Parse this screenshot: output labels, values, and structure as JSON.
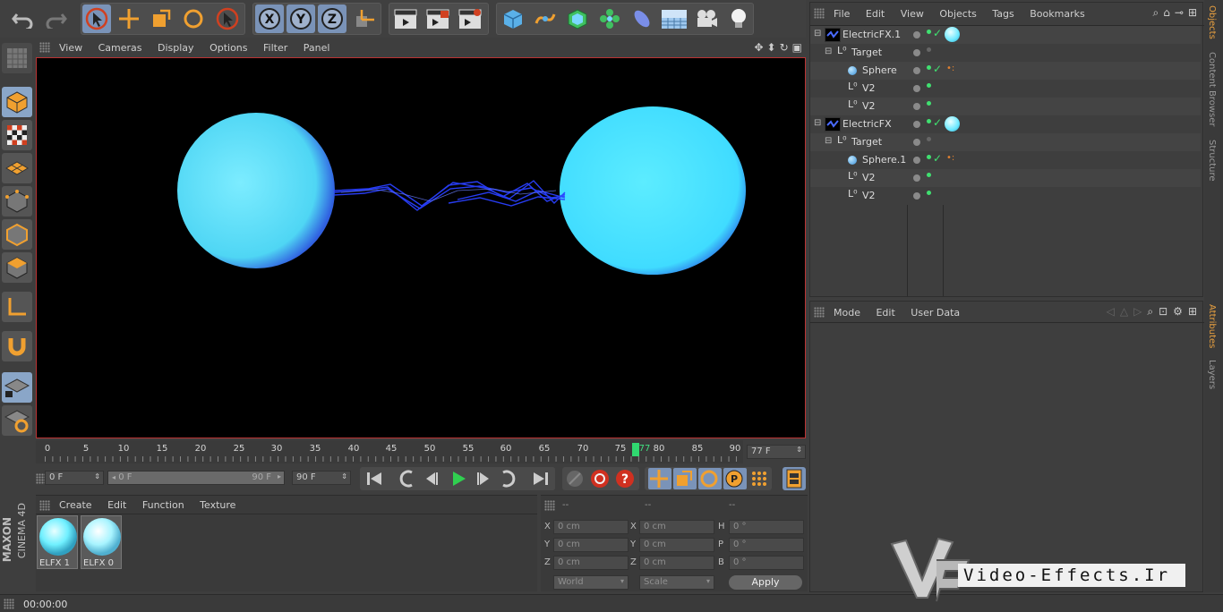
{
  "viewport": {
    "menu": [
      "View",
      "Cameras",
      "Display",
      "Options",
      "Filter",
      "Panel"
    ]
  },
  "objects_panel": {
    "menu": [
      "File",
      "Edit",
      "View",
      "Objects",
      "Tags",
      "Bookmarks"
    ],
    "rows": [
      {
        "name": "ElectricFX.1",
        "level": 0
      },
      {
        "name": "Target",
        "level": 1
      },
      {
        "name": "Sphere",
        "level": 2
      },
      {
        "name": "V2",
        "level": 2
      },
      {
        "name": "V2",
        "level": 2
      },
      {
        "name": "ElectricFX",
        "level": 0
      },
      {
        "name": "Target",
        "level": 1
      },
      {
        "name": "Sphere.1",
        "level": 2
      },
      {
        "name": "V2",
        "level": 2
      },
      {
        "name": "V2",
        "level": 2
      }
    ]
  },
  "attributes_panel": {
    "menu": [
      "Mode",
      "Edit",
      "User Data"
    ]
  },
  "side_tabs": {
    "objects": "Objects",
    "content_browser": "Content Browser",
    "structure": "Structure",
    "attributes": "Attributes",
    "layers": "Layers"
  },
  "timeline": {
    "ticks": [
      "0",
      "5",
      "10",
      "15",
      "20",
      "25",
      "30",
      "35",
      "40",
      "45",
      "50",
      "55",
      "60",
      "65",
      "70",
      "75",
      "80",
      "85",
      "90"
    ],
    "current_frame_label": "77",
    "current_frame_field": "77 F",
    "start_field": "0 F",
    "range_start": "0 F",
    "range_end": "90 F",
    "end_field": "90 F"
  },
  "materials": {
    "menu": [
      "Create",
      "Edit",
      "Function",
      "Texture"
    ],
    "items": [
      {
        "name": "ELFX 1"
      },
      {
        "name": "ELFX 0"
      }
    ]
  },
  "coordinates": {
    "headers": [
      "--",
      "--",
      "--"
    ],
    "rows": [
      {
        "a_lbl": "X",
        "a_val": "0 cm",
        "b_lbl": "X",
        "b_val": "0 cm",
        "c_lbl": "H",
        "c_val": "0 °"
      },
      {
        "a_lbl": "Y",
        "a_val": "0 cm",
        "b_lbl": "Y",
        "b_val": "0 cm",
        "c_lbl": "P",
        "c_val": "0 °"
      },
      {
        "a_lbl": "Z",
        "a_val": "0 cm",
        "b_lbl": "Z",
        "b_val": "0 cm",
        "c_lbl": "B",
        "c_val": "0 °"
      }
    ],
    "space": "World",
    "mode": "Scale",
    "apply": "Apply"
  },
  "status": {
    "time": "00:00:00"
  },
  "branding": {
    "maxon": "MAXON",
    "cinema": "CINEMA 4D"
  },
  "watermark": {
    "text": "Video-Effects.Ir"
  },
  "colors": {
    "sphere": "#56e4ff",
    "accent": "#f0a030",
    "active_tab": "#e8a040"
  }
}
